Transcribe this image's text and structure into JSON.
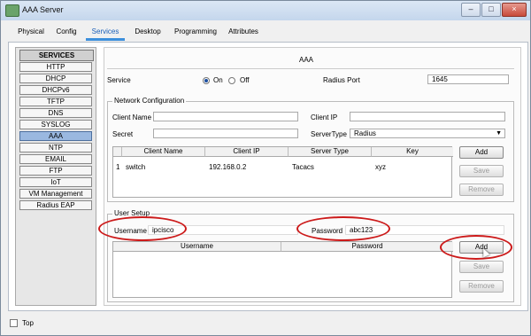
{
  "window": {
    "title": "AAA Server",
    "buttons": {
      "minimize": "–",
      "maximize": "□",
      "close": "×"
    }
  },
  "tabs": [
    {
      "label": "Physical"
    },
    {
      "label": "Config"
    },
    {
      "label": "Services",
      "active": true
    },
    {
      "label": "Desktop"
    },
    {
      "label": "Programming"
    },
    {
      "label": "Attributes"
    }
  ],
  "services": {
    "header": "SERVICES",
    "items": [
      "HTTP",
      "DHCP",
      "DHCPv6",
      "TFTP",
      "DNS",
      "SYSLOG",
      "AAA",
      "NTP",
      "EMAIL",
      "FTP",
      "IoT",
      "VM Management",
      "Radius EAP"
    ],
    "selected": "AAA"
  },
  "aaa": {
    "title": "AAA",
    "service_label": "Service",
    "on_label": "On",
    "off_label": "Off",
    "service_state": "On",
    "radius_port_label": "Radius Port",
    "radius_port_value": "1645"
  },
  "network": {
    "title": "Network Configuration",
    "client_name_label": "Client Name",
    "client_name_value": "",
    "client_ip_label": "Client IP",
    "client_ip_value": "",
    "secret_label": "Secret",
    "secret_value": "",
    "server_type_label": "ServerType",
    "server_type_value": "Radius",
    "table": {
      "headers": [
        "Client Name",
        "Client IP",
        "Server Type",
        "Key"
      ],
      "rows": [
        {
          "num": "1",
          "client_name": "switch",
          "client_ip": "192.168.0.2",
          "server_type": "Tacacs",
          "key": "xyz"
        }
      ]
    },
    "buttons": {
      "add": "Add",
      "save": "Save",
      "remove": "Remove"
    }
  },
  "user_setup": {
    "title": "User Setup",
    "username_label": "Username",
    "username_value": "ipcisco",
    "password_label": "Password",
    "password_value": "abc123",
    "table": {
      "headers": [
        "Username",
        "Password"
      ],
      "rows": []
    },
    "buttons": {
      "add": "Add",
      "save": "Save",
      "remove": "Remove"
    }
  },
  "footer": {
    "top_label": "Top",
    "top_checked": false
  },
  "colors": {
    "highlight_ellipse": "#cc1a1a",
    "active_tab": "#1b5fb8",
    "selected_service": "#9ab8e0"
  }
}
